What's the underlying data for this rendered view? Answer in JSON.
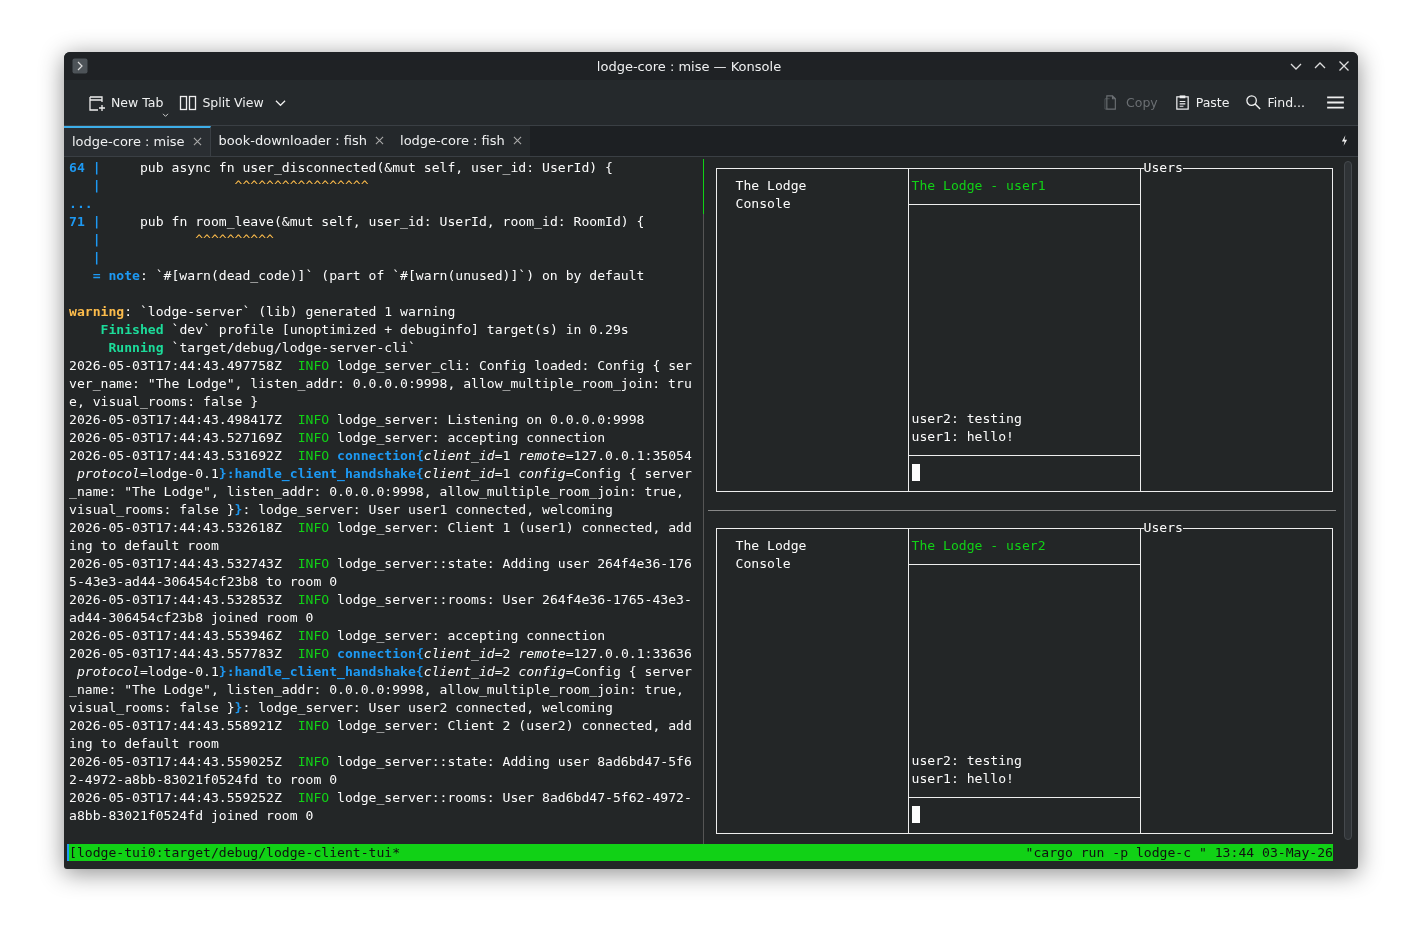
{
  "window": {
    "title": "lodge-core : mise — Konsole"
  },
  "toolbar": {
    "left": [
      {
        "kind": "new-tab",
        "label": "New Tab"
      },
      {
        "kind": "split",
        "label": "Split View"
      }
    ],
    "right": [
      {
        "kind": "copy",
        "label": "Copy",
        "disabled": true
      },
      {
        "kind": "paste",
        "label": "Paste",
        "disabled": false
      },
      {
        "kind": "find",
        "label": "Find...",
        "disabled": false
      }
    ]
  },
  "tabs": [
    {
      "label": "lodge-core : mise",
      "selected": true
    },
    {
      "label": "book-downloader : fish",
      "selected": false
    },
    {
      "label": "lodge-core : fish",
      "selected": false
    }
  ],
  "terminal_lines": [
    {
      "spans": [
        {
          "kind": "gutter",
          "text": "64 |"
        },
        {
          "kind": "plain",
          "text": "     pub async fn user_disconnected(&mut self, user_id: UserId) {"
        }
      ]
    },
    {
      "spans": [
        {
          "kind": "gutter",
          "text": "   |"
        },
        {
          "kind": "caret",
          "text": "                 ^^^^^^^^^^^^^^^^^"
        }
      ]
    },
    {
      "spans": [
        {
          "kind": "gutter",
          "text": "..."
        }
      ]
    },
    {
      "spans": [
        {
          "kind": "gutter",
          "text": "71 |"
        },
        {
          "kind": "plain",
          "text": "     pub fn room_leave(&mut self, user_id: UserId, room_id: RoomId) {"
        }
      ]
    },
    {
      "spans": [
        {
          "kind": "gutter",
          "text": "   |"
        },
        {
          "kind": "caret",
          "text": "            ^^^^^^^^^^"
        }
      ]
    },
    {
      "spans": [
        {
          "kind": "gutter",
          "text": "   |"
        }
      ]
    },
    {
      "spans": [
        {
          "kind": "gutter",
          "text": "   = note"
        },
        {
          "kind": "plain",
          "text": ": `#[warn(dead_code)]` (part of `#[warn(unused)]`) on by default"
        }
      ]
    },
    {
      "gap_before": true,
      "spans": [
        {
          "kind": "warning",
          "text": "warning"
        },
        {
          "kind": "plain",
          "text": ": `lodge-server` (lib) generated 1 warning"
        }
      ]
    },
    {
      "spans": [
        {
          "kind": "status",
          "text": "    Finished"
        },
        {
          "kind": "plain",
          "text": " `dev` profile [unoptimized + debuginfo] target(s) in 0.29s"
        }
      ]
    },
    {
      "spans": [
        {
          "kind": "status",
          "text": "     Running"
        },
        {
          "kind": "plain",
          "text": " `target/debug/lodge-server-cli`"
        }
      ]
    },
    {
      "spans": [
        {
          "kind": "plain",
          "text": "2026-05-03T17:44:43.497758Z  "
        },
        {
          "kind": "info",
          "text": "INFO"
        },
        {
          "kind": "plain",
          "text": " lodge_server_cli: Config loaded: Config { ser"
        }
      ]
    },
    {
      "spans": [
        {
          "kind": "plain",
          "text": "ver_name: \"The Lodge\", listen_addr: 0.0.0.0:9998, allow_multiple_room_join: tru"
        }
      ]
    },
    {
      "spans": [
        {
          "kind": "plain",
          "text": "e, visual_rooms: false }"
        }
      ]
    },
    {
      "spans": [
        {
          "kind": "plain",
          "text": "2026-05-03T17:44:43.498417Z  "
        },
        {
          "kind": "info",
          "text": "INFO"
        },
        {
          "kind": "plain",
          "text": " lodge_server: Listening on 0.0.0.0:9998"
        }
      ]
    },
    {
      "spans": [
        {
          "kind": "plain",
          "text": "2026-05-03T17:44:43.527169Z  "
        },
        {
          "kind": "info",
          "text": "INFO"
        },
        {
          "kind": "plain",
          "text": " lodge_server: accepting connection"
        }
      ]
    },
    {
      "spans": [
        {
          "kind": "plain",
          "text": "2026-05-03T17:44:43.531692Z  "
        },
        {
          "kind": "info",
          "text": "INFO"
        },
        {
          "kind": "span",
          "text": " connection{"
        },
        {
          "kind": "field",
          "text": "client_id"
        },
        {
          "kind": "plain",
          "text": "=1 "
        },
        {
          "kind": "field",
          "text": "remote"
        },
        {
          "kind": "plain",
          "text": "=127.0.0.1:35054"
        }
      ]
    },
    {
      "spans": [
        {
          "kind": "field",
          "text": " protocol"
        },
        {
          "kind": "plain",
          "text": "=lodge-0.1"
        },
        {
          "kind": "span",
          "text": "}:handle_client_handshake{"
        },
        {
          "kind": "field",
          "text": "client_id"
        },
        {
          "kind": "plain",
          "text": "=1 "
        },
        {
          "kind": "field",
          "text": "config"
        },
        {
          "kind": "plain",
          "text": "=Config { server"
        }
      ]
    },
    {
      "spans": [
        {
          "kind": "plain",
          "text": "_name: \"The Lodge\", listen_addr: 0.0.0.0:9998, allow_multiple_room_join: true,"
        }
      ]
    },
    {
      "spans": [
        {
          "kind": "plain",
          "text": "visual_rooms: false }"
        },
        {
          "kind": "span",
          "text": "}"
        },
        {
          "kind": "plain",
          "text": ": lodge_server: User user1 connected, welcoming"
        }
      ]
    },
    {
      "spans": [
        {
          "kind": "plain",
          "text": "2026-05-03T17:44:43.532618Z  "
        },
        {
          "kind": "info",
          "text": "INFO"
        },
        {
          "kind": "plain",
          "text": " lodge_server: Client 1 (user1) connected, add"
        }
      ]
    },
    {
      "spans": [
        {
          "kind": "plain",
          "text": "ing to default room"
        }
      ]
    },
    {
      "spans": [
        {
          "kind": "plain",
          "text": "2026-05-03T17:44:43.532743Z  "
        },
        {
          "kind": "info",
          "text": "INFO"
        },
        {
          "kind": "plain",
          "text": " lodge_server::state: Adding user 264f4e36-176"
        }
      ]
    },
    {
      "spans": [
        {
          "kind": "plain",
          "text": "5-43e3-ad44-306454cf23b8 to room 0"
        }
      ]
    },
    {
      "spans": [
        {
          "kind": "plain",
          "text": "2026-05-03T17:44:43.532853Z  "
        },
        {
          "kind": "info",
          "text": "INFO"
        },
        {
          "kind": "plain",
          "text": " lodge_server::rooms: User 264f4e36-1765-43e3-"
        }
      ]
    },
    {
      "spans": [
        {
          "kind": "plain",
          "text": "ad44-306454cf23b8 joined room 0"
        }
      ]
    },
    {
      "spans": [
        {
          "kind": "plain",
          "text": "2026-05-03T17:44:43.553946Z  "
        },
        {
          "kind": "info",
          "text": "INFO"
        },
        {
          "kind": "plain",
          "text": " lodge_server: accepting connection"
        }
      ]
    },
    {
      "spans": [
        {
          "kind": "plain",
          "text": "2026-05-03T17:44:43.557783Z  "
        },
        {
          "kind": "info",
          "text": "INFO"
        },
        {
          "kind": "span",
          "text": " connection{"
        },
        {
          "kind": "field",
          "text": "client_id"
        },
        {
          "kind": "plain",
          "text": "=2 "
        },
        {
          "kind": "field",
          "text": "remote"
        },
        {
          "kind": "plain",
          "text": "=127.0.0.1:33636"
        }
      ]
    },
    {
      "spans": [
        {
          "kind": "field",
          "text": " protocol"
        },
        {
          "kind": "plain",
          "text": "=lodge-0.1"
        },
        {
          "kind": "span",
          "text": "}:handle_client_handshake{"
        },
        {
          "kind": "field",
          "text": "client_id"
        },
        {
          "kind": "plain",
          "text": "=2 "
        },
        {
          "kind": "field",
          "text": "config"
        },
        {
          "kind": "plain",
          "text": "=Config { server"
        }
      ]
    },
    {
      "spans": [
        {
          "kind": "plain",
          "text": "_name: \"The Lodge\", listen_addr: 0.0.0.0:9998, allow_multiple_room_join: true,"
        }
      ]
    },
    {
      "spans": [
        {
          "kind": "plain",
          "text": "visual_rooms: false }"
        },
        {
          "kind": "span",
          "text": "}"
        },
        {
          "kind": "plain",
          "text": ": lodge_server: User user2 connected, welcoming"
        }
      ]
    },
    {
      "spans": [
        {
          "kind": "plain",
          "text": "2026-05-03T17:44:43.558921Z  "
        },
        {
          "kind": "info",
          "text": "INFO"
        },
        {
          "kind": "plain",
          "text": " lodge_server: Client 2 (user2) connected, add"
        }
      ]
    },
    {
      "spans": [
        {
          "kind": "plain",
          "text": "ing to default room"
        }
      ]
    },
    {
      "spans": [
        {
          "kind": "plain",
          "text": "2026-05-03T17:44:43.559025Z  "
        },
        {
          "kind": "info",
          "text": "INFO"
        },
        {
          "kind": "plain",
          "text": " lodge_server::state: Adding user 8ad6bd47-5f6"
        }
      ]
    },
    {
      "spans": [
        {
          "kind": "plain",
          "text": "2-4972-a8bb-83021f0524fd to room 0"
        }
      ]
    },
    {
      "spans": [
        {
          "kind": "plain",
          "text": "2026-05-03T17:44:43.559252Z  "
        },
        {
          "kind": "info",
          "text": "INFO"
        },
        {
          "kind": "plain",
          "text": " lodge_server::rooms: User 8ad6bd47-5f62-4972-"
        }
      ]
    },
    {
      "spans": [
        {
          "kind": "plain",
          "text": "a8bb-83021f0524fd joined room 0"
        }
      ]
    }
  ],
  "chat_panes": [
    {
      "sidebar_lines": [
        "The Lodge",
        "Console"
      ],
      "chat_title": "The Lodge - user1",
      "messages": [
        "user2: testing",
        "user1: hello!"
      ],
      "users_title": "Users"
    },
    {
      "sidebar_lines": [
        "The Lodge",
        "Console"
      ],
      "chat_title": "The Lodge - user2",
      "messages": [
        "user2: testing",
        "user1: hello!"
      ],
      "users_title": "Users"
    }
  ],
  "status_bar": {
    "left": "[lodge-tui0:target/debug/lodge-client-tui*",
    "right": "\"cargo run -p lodge-c \" 13:44 03-May-26"
  }
}
